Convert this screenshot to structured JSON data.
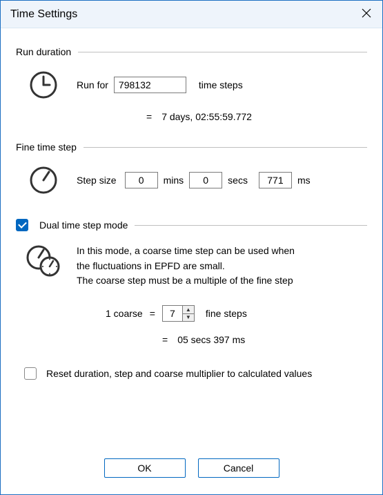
{
  "title": "Time Settings",
  "sections": {
    "runDuration": {
      "label": "Run duration",
      "runForLabel": "Run for",
      "runForValue": "798132",
      "runForUnit": "time steps",
      "eqSign": "=",
      "eqValue": "7 days, 02:55:59.772"
    },
    "fineTimeStep": {
      "label": "Fine time step",
      "stepSizeLabel": "Step size",
      "mins": "0",
      "minsLabel": "mins",
      "secs": "0",
      "secsLabel": "secs",
      "ms": "771",
      "msLabel": "ms"
    },
    "dualMode": {
      "checked": true,
      "label": "Dual time step mode",
      "descLine1": "In this mode, a coarse time step can be used when",
      "descLine2": "the fluctuations in EPFD are small.",
      "descLine3": "The coarse step must be a multiple of the fine step",
      "coarseLeft": "1 coarse",
      "eq1": "=",
      "coarseValue": "7",
      "coarseRight": "fine steps",
      "eq2": "=",
      "eqValue": "05 secs 397 ms"
    },
    "reset": {
      "checked": false,
      "label": "Reset duration, step and coarse multiplier to calculated values"
    }
  },
  "buttons": {
    "ok": "OK",
    "cancel": "Cancel"
  }
}
